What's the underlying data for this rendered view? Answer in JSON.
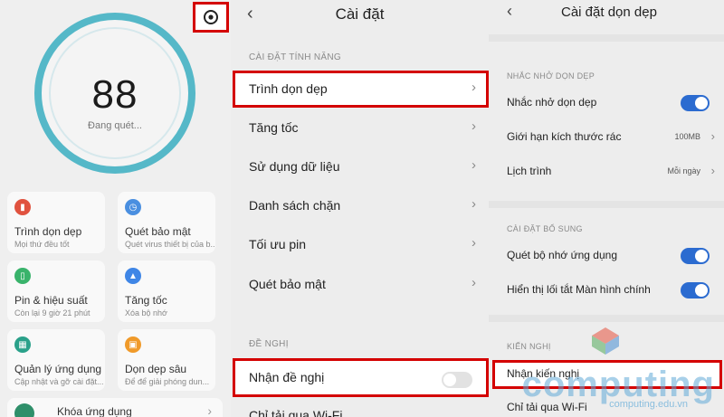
{
  "panel1": {
    "score": "88",
    "scanning": "Đang quét...",
    "cards": [
      {
        "title": "Trình dọn dẹp",
        "sub": "Mọi thứ đều tốt",
        "icon": "trash-icon",
        "color": "#e0523f"
      },
      {
        "title": "Quét bảo mật",
        "sub": "Quét virus thiết bị của b...",
        "icon": "shield-icon",
        "color": "#4a8fe0"
      },
      {
        "title": "Pin & hiệu suất",
        "sub": "Còn lại 9 giờ 21 phút",
        "icon": "battery-icon",
        "color": "#39b36b"
      },
      {
        "title": "Tăng tốc",
        "sub": "Xóa bộ nhớ",
        "icon": "rocket-icon",
        "color": "#3f86e6"
      },
      {
        "title": "Quản lý ứng dụng",
        "sub": "Cập nhật và gỡ cài đặt...",
        "icon": "apps-icon",
        "color": "#2aa18a"
      },
      {
        "title": "Dọn dẹp sâu",
        "sub": "Để để giải phóng dun...",
        "icon": "broom-icon",
        "color": "#f09a2a"
      }
    ],
    "bottom_card": {
      "title": "Khóa ứng dụng"
    }
  },
  "panel2": {
    "title": "Cài đặt",
    "section_features": "CÀI ĐẶT TÍNH NĂNG",
    "items": [
      {
        "label": "Trình dọn dẹp"
      },
      {
        "label": "Tăng tốc"
      },
      {
        "label": "Sử dụng dữ liệu"
      },
      {
        "label": "Danh sách chặn"
      },
      {
        "label": "Tối ưu pin"
      },
      {
        "label": "Quét bảo mật"
      }
    ],
    "section_suggest": "ĐỀ NGHỊ",
    "suggest_label": "Nhận đề nghị",
    "wifi_label": "Chỉ tải qua Wi-Fi"
  },
  "panel3": {
    "title": "Cài đặt dọn dẹp",
    "section_reminder": "NHẮC NHỞ DỌN DẸP",
    "reminder_label": "Nhắc nhở dọn dẹp",
    "limit_label": "Giới hạn kích thước rác",
    "limit_value": "100MB",
    "schedule_label": "Lịch trình",
    "schedule_value": "Mỗi ngày",
    "section_extra": "CÀI ĐẶT BỔ SUNG",
    "scan_memory_label": "Quét bộ nhớ ứng dụng",
    "shortcut_label": "Hiển thị lối tắt Màn hình chính",
    "section_recommend": "KIẾN NGHỊ",
    "recommend_label": "Nhận kiến nghị",
    "wifi_label": "Chỉ tải qua Wi-Fi"
  },
  "watermark": {
    "brand": "computing",
    "domain": "computing.edu.vn"
  },
  "colors": {
    "highlight": "#d40000",
    "toggle_on": "#2b6bd0",
    "ring": "#55b8c8"
  }
}
